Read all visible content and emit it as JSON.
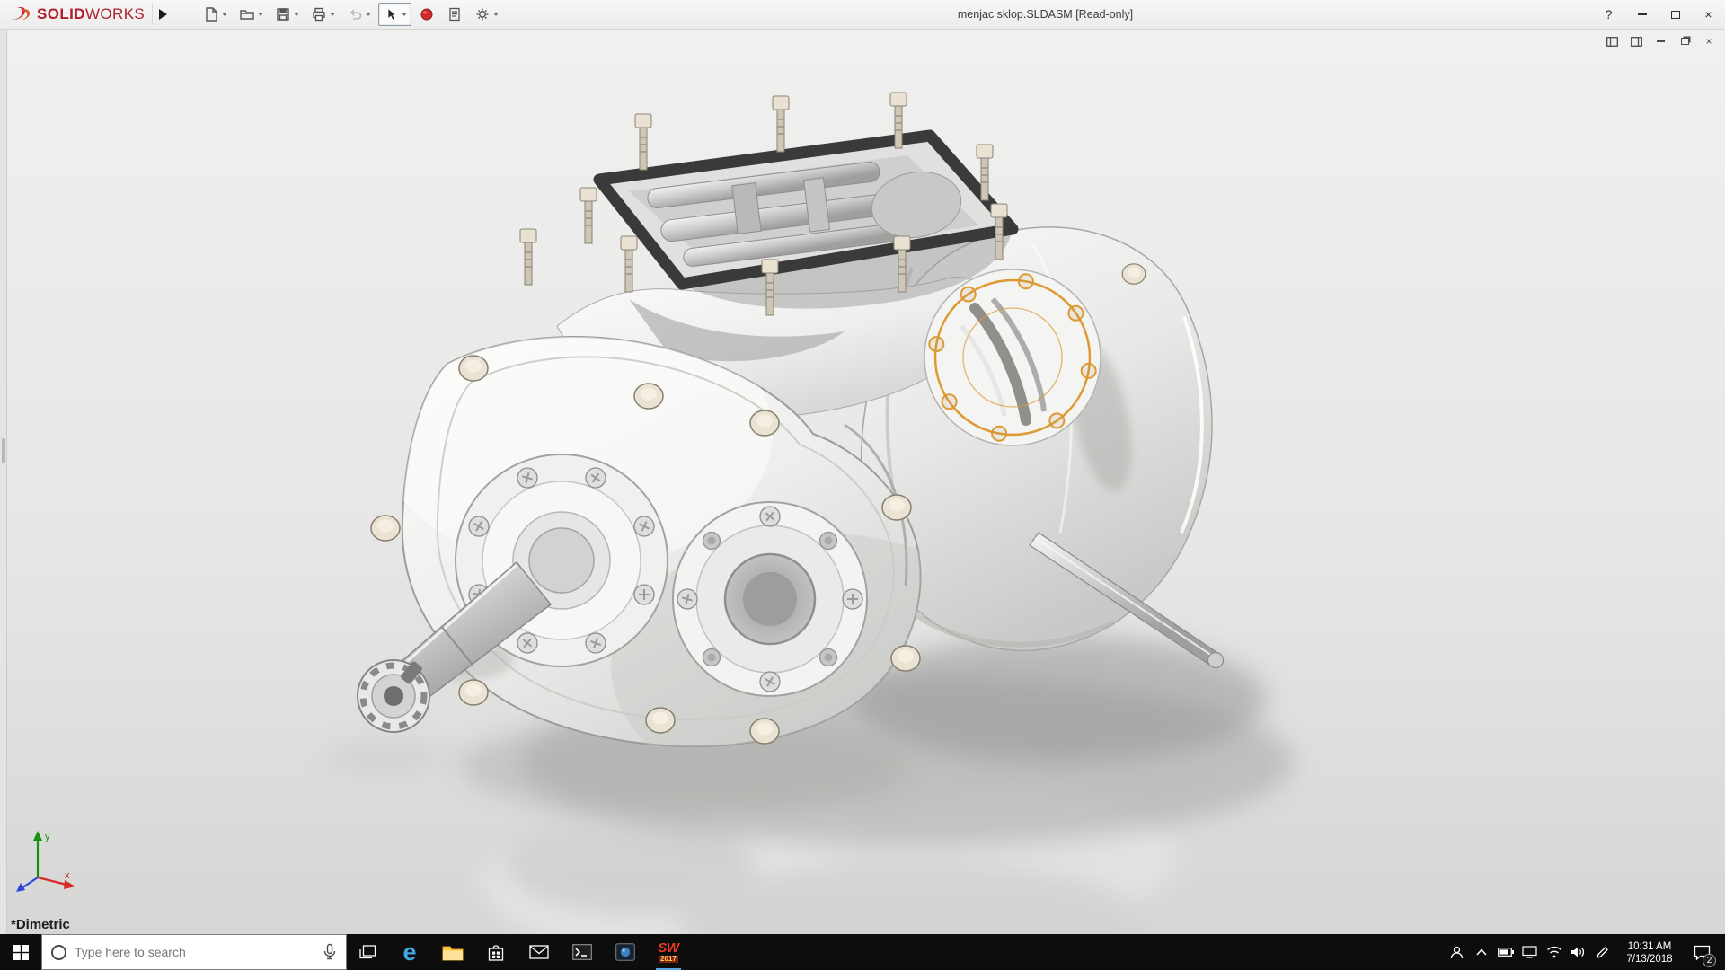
{
  "window": {
    "brand_bold": "SOLID",
    "brand_light": "WORKS",
    "title": "menjac sklop.SLDASM [Read-only]",
    "help_glyph": "?",
    "close_glyph": "×"
  },
  "toolbar": {
    "tools": [
      {
        "name": "new"
      },
      {
        "name": "open"
      },
      {
        "name": "save"
      },
      {
        "name": "print"
      },
      {
        "name": "undo"
      },
      {
        "name": "select"
      },
      {
        "name": "rebuild"
      },
      {
        "name": "file-properties"
      },
      {
        "name": "options"
      }
    ]
  },
  "doc_window": {
    "close_glyph": "×"
  },
  "viewport": {
    "view_label": "*Dimetric",
    "selection_color": "#DD9A33",
    "triad": {
      "x_label": "x",
      "y_label": "y"
    }
  },
  "taskbar": {
    "search_placeholder": "Type here to search",
    "edge_glyph": "e",
    "sw_app": {
      "abbr": "SW",
      "year": "2017"
    },
    "clock_time": "10:31 AM",
    "clock_date": "7/13/2018",
    "notification_badge": "2"
  }
}
